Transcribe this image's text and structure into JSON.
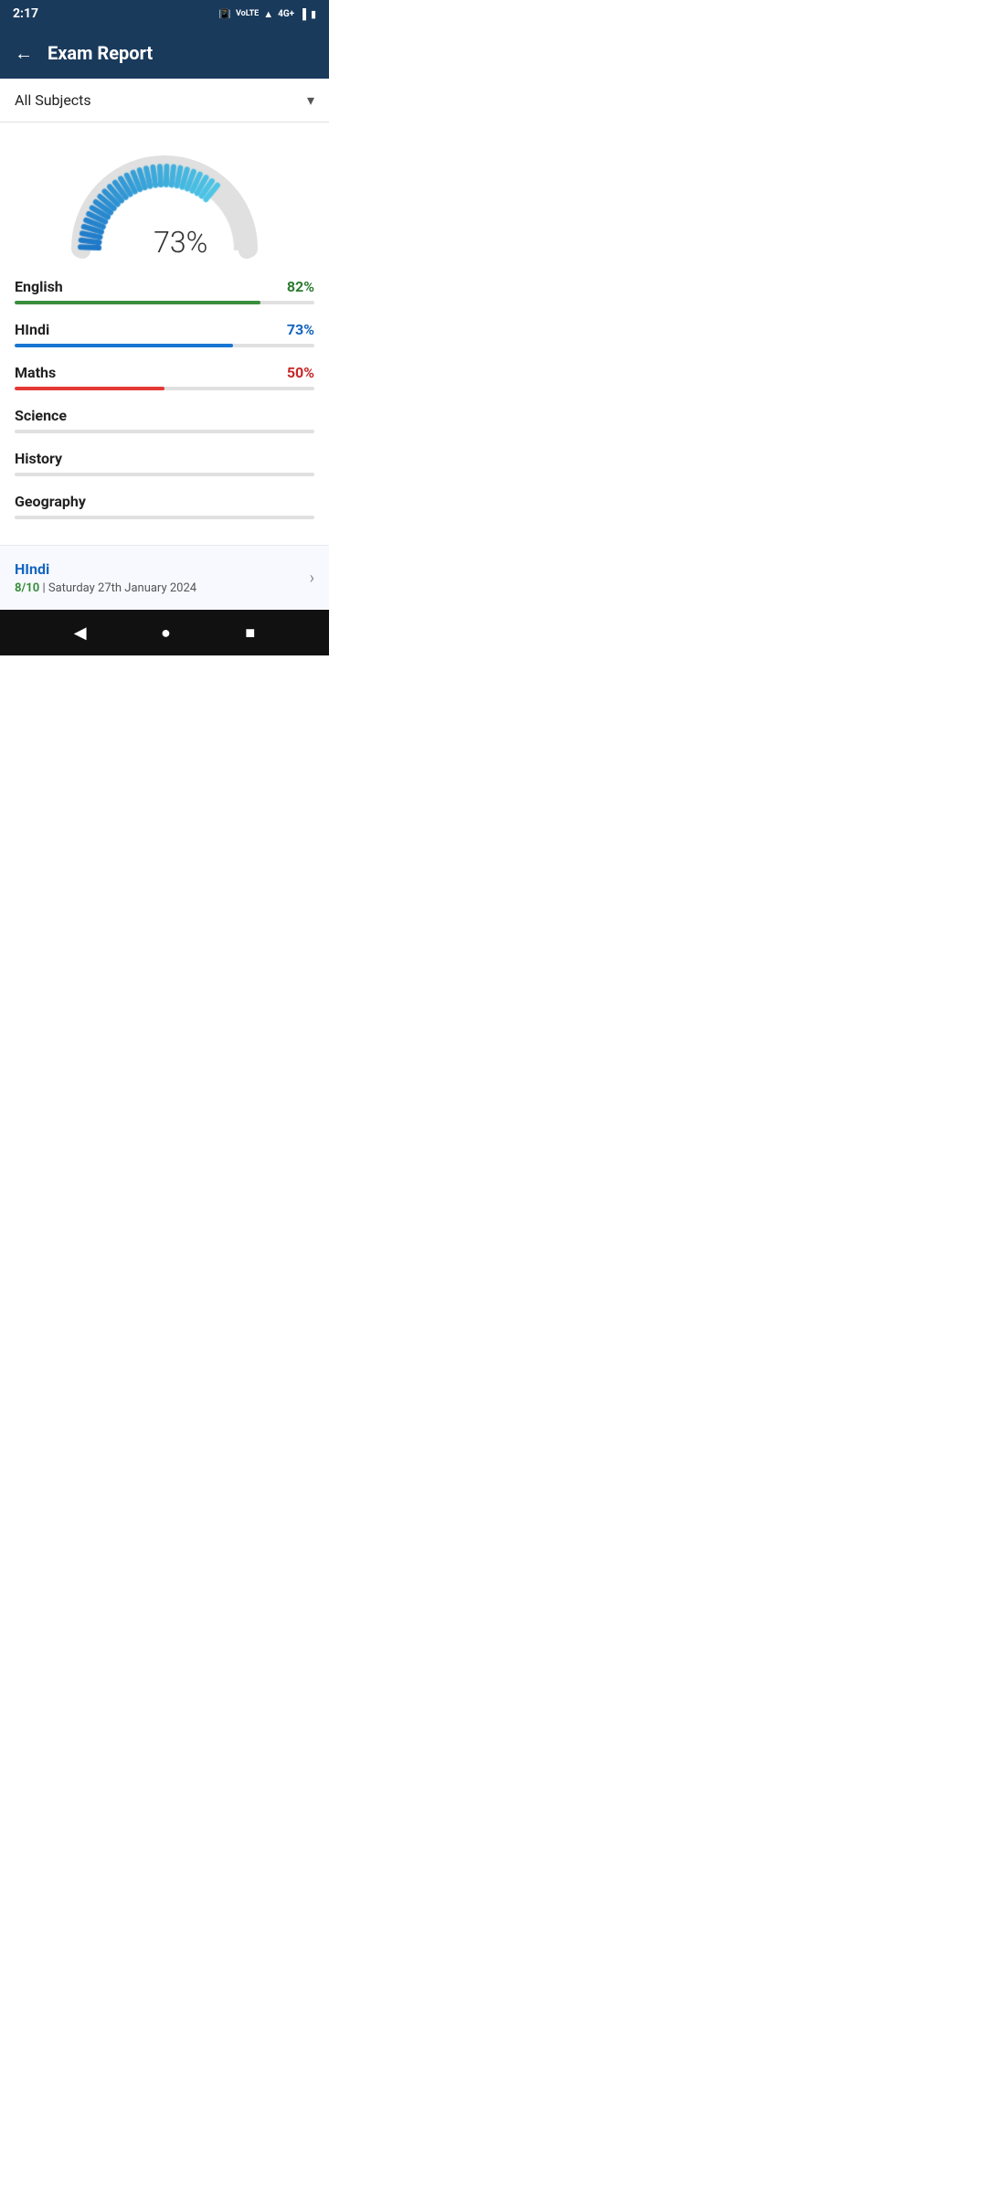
{
  "statusBar": {
    "time": "2:17",
    "icons": [
      "vibrate",
      "volte",
      "wifi",
      "4g",
      "signal",
      "battery"
    ]
  },
  "header": {
    "title": "Exam Report",
    "backArrow": "←"
  },
  "subjectDropdown": {
    "label": "All Subjects",
    "arrow": "▾"
  },
  "gauge": {
    "value": "73%",
    "percent": 73
  },
  "subjects": [
    {
      "name": "English",
      "score": "82%",
      "percent": 82,
      "color": "green"
    },
    {
      "name": "HIndi",
      "score": "73%",
      "percent": 73,
      "color": "blue"
    },
    {
      "name": "Maths",
      "score": "50%",
      "percent": 50,
      "color": "red"
    },
    {
      "name": "Science",
      "score": "",
      "percent": 0,
      "color": "gray"
    },
    {
      "name": "History",
      "score": "",
      "percent": 0,
      "color": "gray"
    },
    {
      "name": "Geography",
      "score": "",
      "percent": 0,
      "color": "gray"
    }
  ],
  "recentExam": {
    "title": "HIndi",
    "score": "8/10",
    "date": "Saturday 27th January 2024",
    "chevron": "›"
  },
  "navBar": {
    "back": "◀",
    "home": "●",
    "square": "■"
  }
}
